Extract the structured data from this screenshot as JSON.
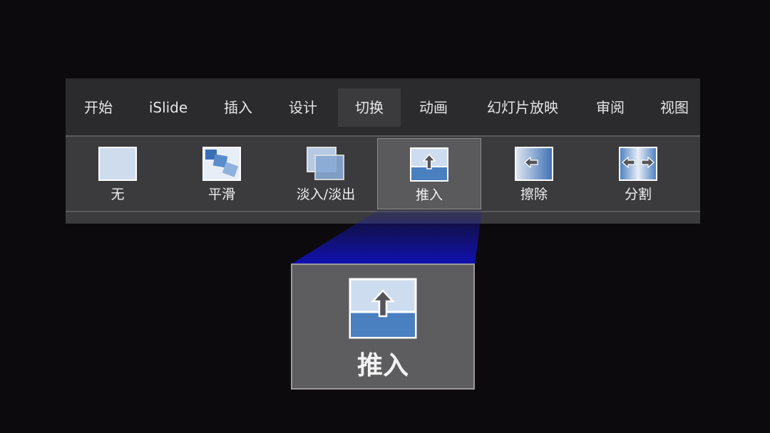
{
  "tabs": [
    {
      "label": "开始"
    },
    {
      "label": "iSlide"
    },
    {
      "label": "插入"
    },
    {
      "label": "设计"
    },
    {
      "label": "切换"
    },
    {
      "label": "动画"
    },
    {
      "label": "幻灯片放映"
    },
    {
      "label": "审阅"
    },
    {
      "label": "视图"
    }
  ],
  "active_tab": "切换",
  "transitions": [
    {
      "label": "无",
      "icon": "none-transition-icon"
    },
    {
      "label": "平滑",
      "icon": "morph-transition-icon"
    },
    {
      "label": "淡入/淡出",
      "icon": "fade-transition-icon"
    },
    {
      "label": "推入",
      "icon": "push-up-transition-icon"
    },
    {
      "label": "擦除",
      "icon": "wipe-left-transition-icon"
    },
    {
      "label": "分割",
      "icon": "split-transition-icon"
    }
  ],
  "selected_transition": "推入",
  "zoom_callout": {
    "label": "推入",
    "icon": "push-up-transition-icon"
  },
  "colors": {
    "background": "#0c0a0d",
    "ribbon": "#3b3a3d",
    "selected": "#5a595c",
    "beam": "#1a1ab8",
    "thumb_light": "#c9d8ec",
    "thumb_blue": "#4a7fc0"
  }
}
